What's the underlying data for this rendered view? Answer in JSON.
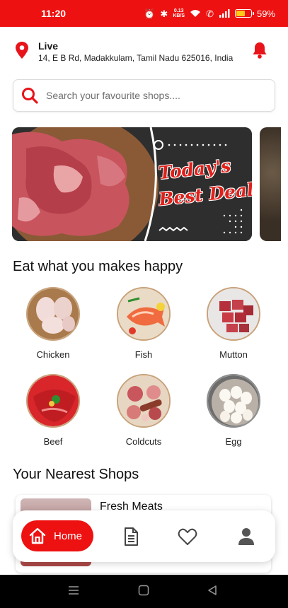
{
  "status_bar": {
    "time": "11:20",
    "net_speed_value": "0.13",
    "net_speed_unit": "KB/S",
    "battery_percent": "59%",
    "battery_level": 0.59
  },
  "header": {
    "location_title": "Live",
    "address": "14, E B Rd, Madakkulam, Tamil Nadu 625016, India"
  },
  "search": {
    "placeholder": "Search your favourite shops...."
  },
  "banner": {
    "line1": "Today's",
    "line2": "Best Deal!"
  },
  "categories_section": {
    "title": "Eat what you makes happy",
    "items": [
      {
        "label": "Chicken"
      },
      {
        "label": "Fish"
      },
      {
        "label": "Mutton"
      },
      {
        "label": "Beef"
      },
      {
        "label": "Coldcuts"
      },
      {
        "label": "Egg"
      }
    ]
  },
  "shops_section": {
    "title": "Your Nearest Shops",
    "shops": [
      {
        "name": "Fresh Meats"
      }
    ]
  },
  "bottom_nav": {
    "home_label": "Home",
    "icons": [
      "home-icon",
      "orders-icon",
      "heart-icon",
      "profile-icon"
    ]
  },
  "colors": {
    "accent": "#ee1111",
    "banner_bg": "#2c2c2c"
  }
}
